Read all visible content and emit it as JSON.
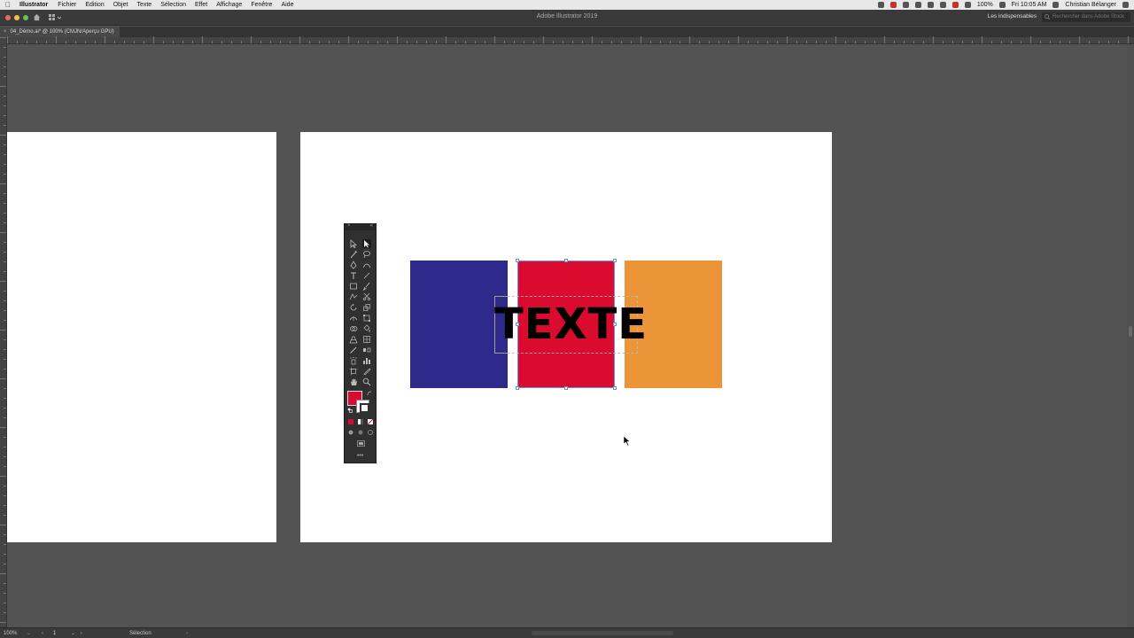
{
  "menubar": {
    "app_name": "Illustrator",
    "items": [
      "Fichier",
      "Edition",
      "Objet",
      "Texte",
      "Sélection",
      "Effet",
      "Affichage",
      "Fenêtre",
      "Aide"
    ],
    "battery": "100%",
    "clock": "Fri 10:05 AM",
    "user": "Christian Bélanger"
  },
  "appbar": {
    "title": "Adobe Illustrator 2019",
    "workspace": "Les indispensables",
    "stock_search_placeholder": "Rechercher dans Adobe Stock"
  },
  "document_tab": {
    "label": "04_Démo.ai* @ 100% (CMJN/Aperçu GPU)",
    "close": "×"
  },
  "artwork": {
    "text": "TEXTE",
    "colors": {
      "blue": "#2e2a8c",
      "red": "#db0a2f",
      "orange": "#ec9438"
    }
  },
  "tools_panel": {
    "fill_color": "#db0a2f",
    "stroke_color": "#ffffff",
    "more": "•••"
  },
  "statusbar": {
    "zoom": "100%",
    "page": "1",
    "mode": "Sélection"
  }
}
